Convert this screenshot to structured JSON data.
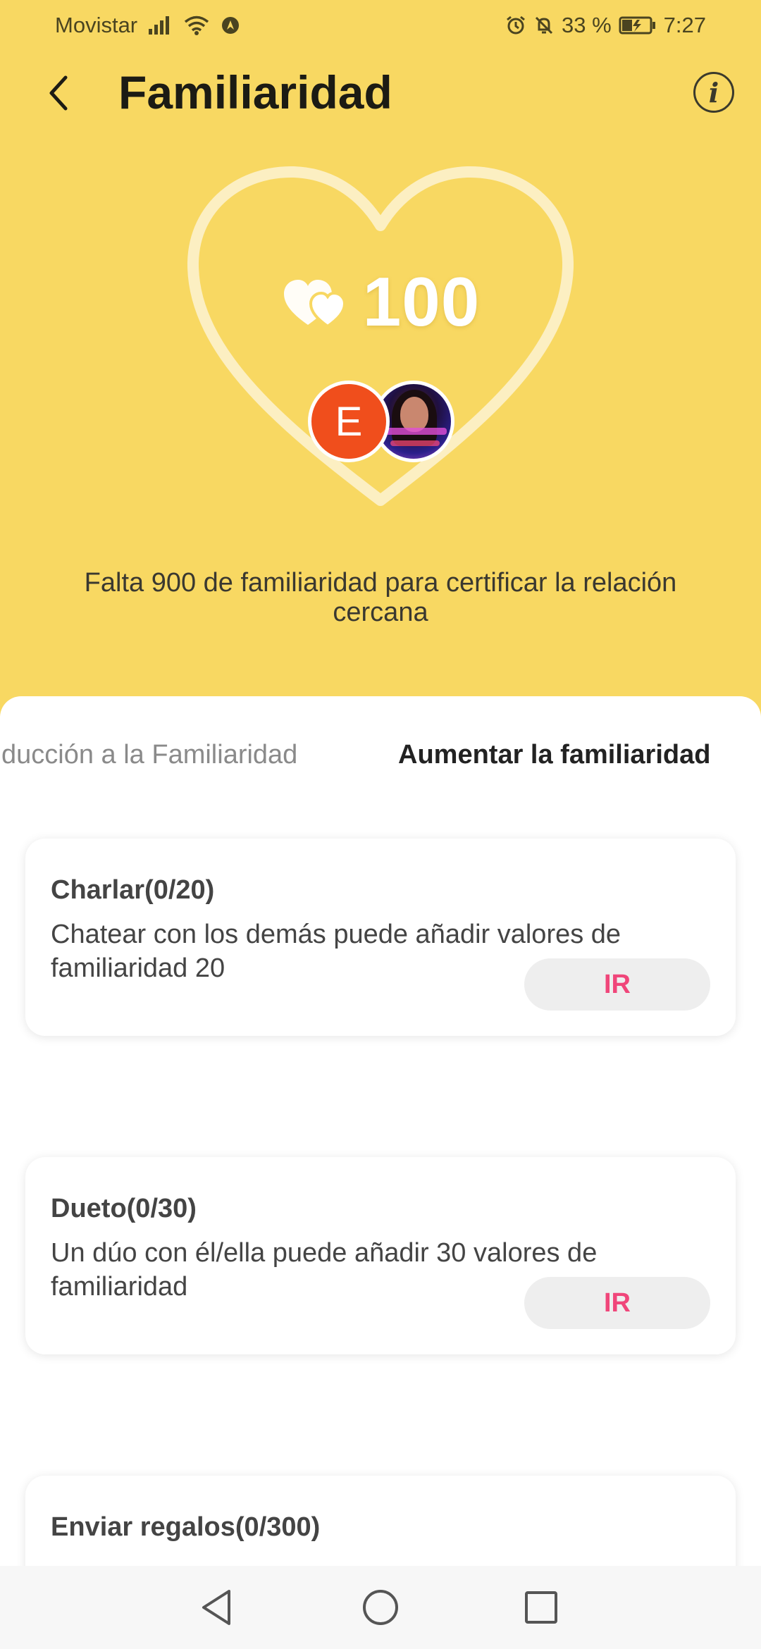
{
  "status_bar": {
    "carrier": "Movistar",
    "battery_percent": "33 %",
    "time": "7:27"
  },
  "header": {
    "title": "Familiaridad",
    "info_label": "i"
  },
  "familiarity": {
    "score": "100",
    "partner_initial": "E",
    "hint": "Falta 900 de familiaridad para certificar la relación cercana"
  },
  "tabs": [
    {
      "label": "ducción a la Familiaridad",
      "active": false
    },
    {
      "label": "Aumentar la familiaridad",
      "active": true
    }
  ],
  "tasks": [
    {
      "title": "Charlar(0/20)",
      "description": "Chatear con los demás puede añadir valores de familiaridad 20",
      "button": "IR"
    },
    {
      "title": "Dueto(0/30)",
      "description": "Un dúo con él/ella puede añadir 30 valores de familiaridad",
      "button": "IR"
    },
    {
      "title": "Enviar regalos(0/300)",
      "description": "",
      "button": ""
    }
  ],
  "colors": {
    "background": "#f8d862",
    "accent_button_text": "#f0467a",
    "avatar_e": "#f04e1c"
  }
}
